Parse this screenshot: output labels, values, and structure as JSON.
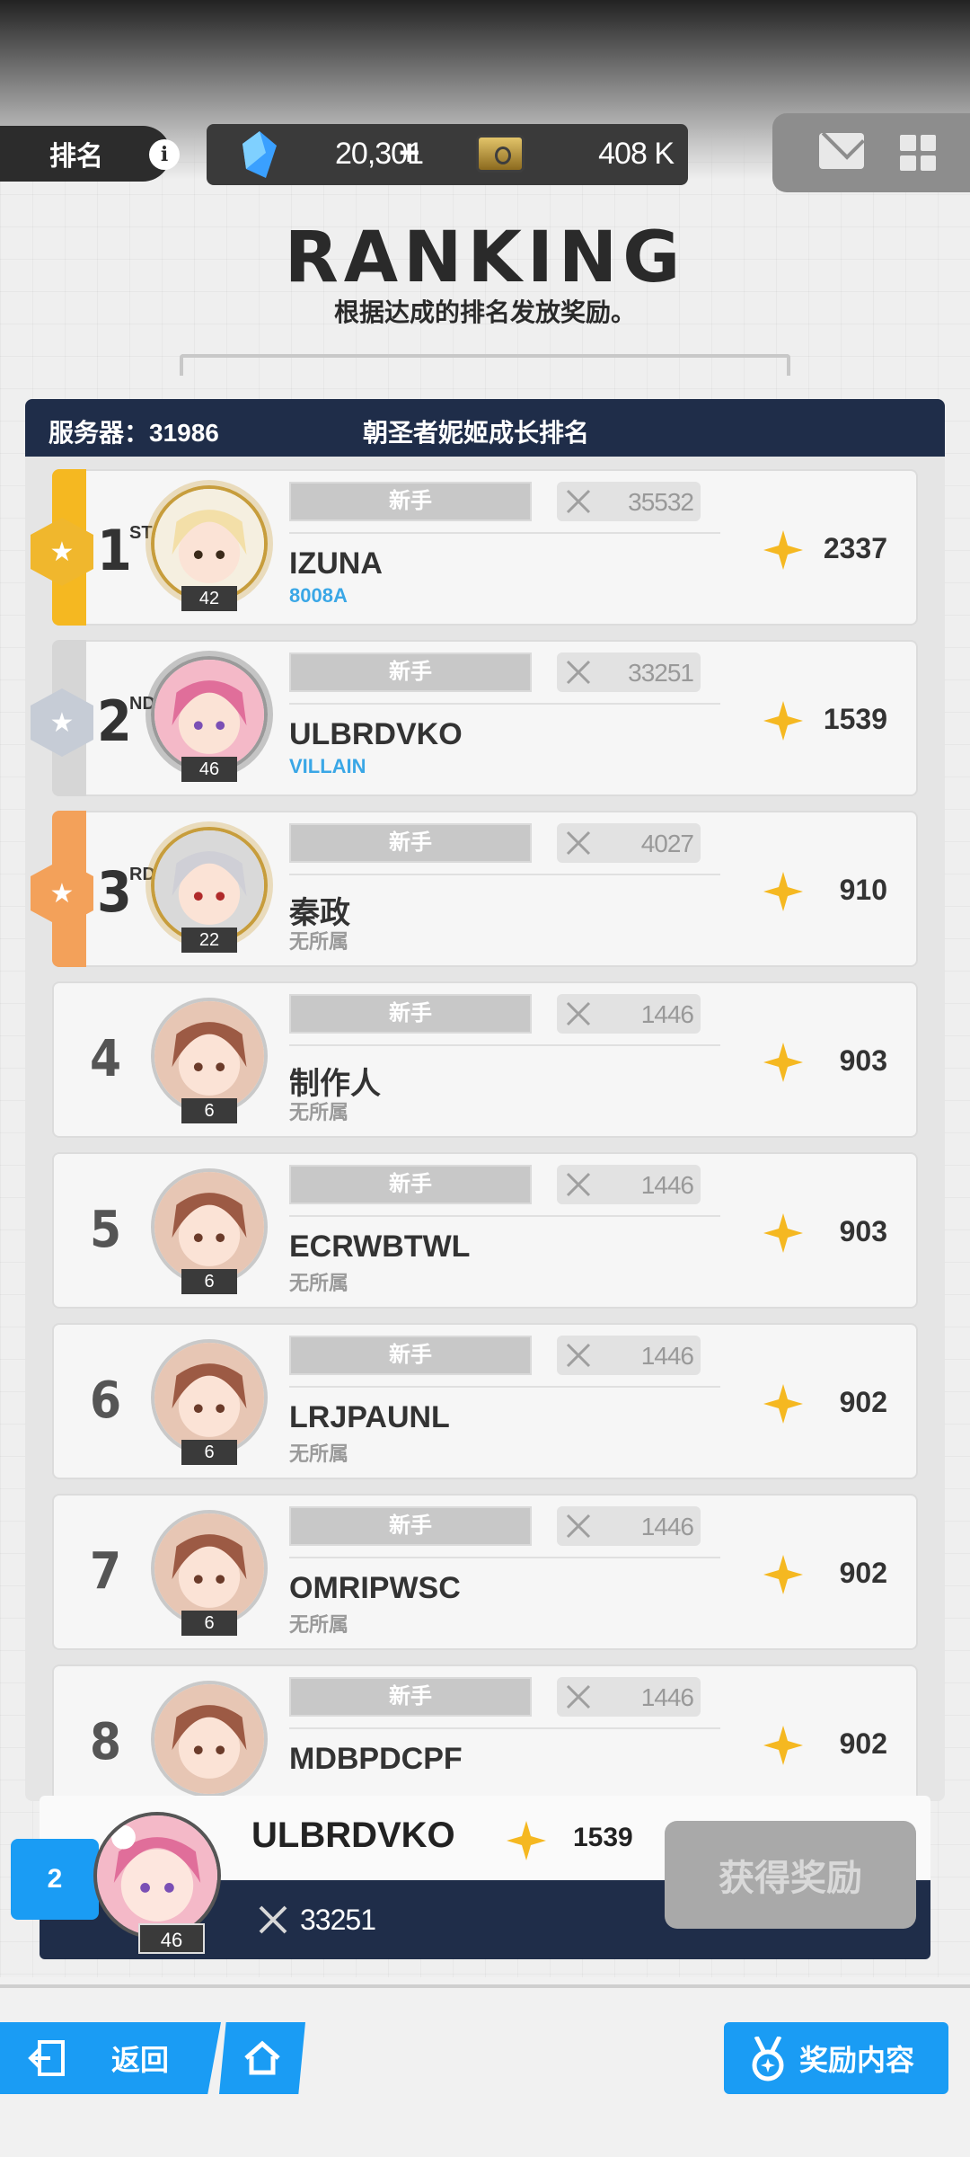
{
  "topbar": {
    "rank_label": "排名",
    "info_icon": "info-icon",
    "gems": "20,301",
    "plus": "+",
    "credits": "408 K"
  },
  "header": {
    "title": "RANKING",
    "subtitle": "根据达成的排名发放奖励。"
  },
  "board": {
    "server": "服务器：31986",
    "title": "朝圣者妮姬成长排名",
    "tier": "新手",
    "rows": [
      {
        "rank": "1",
        "suffix": "ST",
        "name": "IZUNA",
        "union": "8008A",
        "level": "42",
        "power": "35532",
        "score": "2337"
      },
      {
        "rank": "2",
        "suffix": "ND",
        "name": "ULBRDVKO",
        "union": "VILLAIN",
        "level": "46",
        "power": "33251",
        "score": "1539"
      },
      {
        "rank": "3",
        "suffix": "RD",
        "name": "秦政",
        "union": "无所属",
        "level": "22",
        "power": "4027",
        "score": "910"
      },
      {
        "rank": "4",
        "name": "制作人",
        "union": "无所属",
        "level": "6",
        "power": "1446",
        "score": "903"
      },
      {
        "rank": "5",
        "name": "ECRWBTWL",
        "union": "无所属",
        "level": "6",
        "power": "1446",
        "score": "903"
      },
      {
        "rank": "6",
        "name": "LRJPAUNL",
        "union": "无所属",
        "level": "6",
        "power": "1446",
        "score": "902"
      },
      {
        "rank": "7",
        "name": "OMRIPWSC",
        "union": "无所属",
        "level": "6",
        "power": "1446",
        "score": "902"
      },
      {
        "rank": "8",
        "name": "MDBPDCPF",
        "union": "",
        "level": "",
        "power": "1446",
        "score": "902"
      }
    ]
  },
  "my_rank": {
    "rank": "2",
    "name": "ULBRDVKO",
    "score": "1539",
    "level": "46",
    "power": "33251",
    "claim_label": "获得奖励"
  },
  "footer": {
    "back_label": "返回",
    "reward_label": "奖励内容"
  },
  "colors": {
    "accent_blue": "#1a9cf4",
    "navy": "#1f2d49",
    "gold": "#f5b821",
    "silver": "#c6ccd6",
    "bronze": "#f3a15a"
  }
}
